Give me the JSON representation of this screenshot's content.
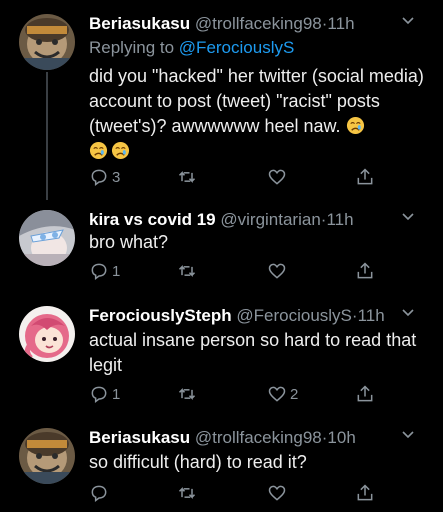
{
  "tweets": [
    {
      "display_name": "Beriasukasu",
      "handle": "@trollfaceking98",
      "separator": "·",
      "time": "11h",
      "replying_prefix": "Replying to",
      "replying_handle": "@FerociouslyS",
      "text": "did you \"hacked\" her twitter (social media) account to post (tweet) \"racist\" posts (tweet's)? awwwwww heel naw.",
      "emoji": [
        "crying-face",
        "crying-face",
        "crying-face"
      ],
      "reply_count": "3",
      "retweet_count": "",
      "like_count": "",
      "avatar": "troll-face-avatar"
    },
    {
      "display_name": "kira vs covid 19",
      "handle": "@virgintarian",
      "separator": "·",
      "time": "11h",
      "text": "bro what?",
      "reply_count": "1",
      "retweet_count": "",
      "like_count": "",
      "avatar": "anime-girl-avatar"
    },
    {
      "display_name": "FerociouslySteph",
      "handle": "@FerociouslyS",
      "separator": "·",
      "time": "11h",
      "text": "actual insane person so hard to read that legit",
      "reply_count": "1",
      "retweet_count": "",
      "like_count": "2",
      "avatar": "pink-hair-avatar"
    },
    {
      "display_name": "Beriasukasu",
      "handle": "@trollfaceking98",
      "separator": "·",
      "time": "10h",
      "text": "so difficult (hard) to read it?",
      "reply_count": "",
      "retweet_count": "",
      "like_count": "",
      "avatar": "troll-face-avatar"
    }
  ],
  "colors": {
    "background": "#000000",
    "text": "#eeeeee",
    "muted": "#8b949c",
    "link": "#1d9bf0",
    "thread_line": "#3a3f44"
  }
}
